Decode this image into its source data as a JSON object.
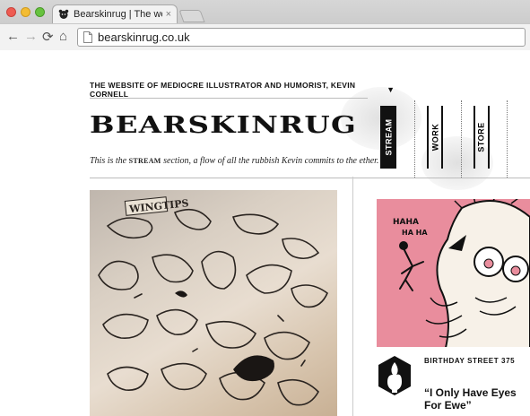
{
  "browser": {
    "tab_title": "Bearskinrug | The website",
    "tab_close": "×",
    "url": "bearskinrug.co.uk",
    "back_glyph": "←",
    "forward_glyph": "→",
    "reload_glyph": "⟳",
    "home_glyph": "⌂",
    "icons": [
      "back-icon",
      "forward-icon",
      "reload-icon",
      "home-icon",
      "page-icon",
      "bear-favicon"
    ]
  },
  "site": {
    "tagline": "THE WEBSITE OF MEDIOCRE ILLUSTRATOR AND HUMORIST, KEVIN CORNELL",
    "tagline_arrow": "▼",
    "logo": "BEARSKINRUG",
    "desc_before": "This is the ",
    "desc_section": "STREAM",
    "desc_after": " section, a flow of all the rubbish Kevin commits to the ether.",
    "nav": [
      {
        "label": "STREAM",
        "active": true
      },
      {
        "label": "WORK",
        "active": false
      },
      {
        "label": "STORE",
        "active": false
      }
    ]
  },
  "stream": {
    "photo_sign": "WINGTIPS",
    "illustration_text": [
      "HAHA",
      "HA HA"
    ],
    "entry_label": "BIRTHDAY STREET 375",
    "entry_title": "“I Only Have Eyes For Ewe”"
  },
  "colors": {
    "illustration_pink": "#e98d9d",
    "ink": "#111111"
  }
}
